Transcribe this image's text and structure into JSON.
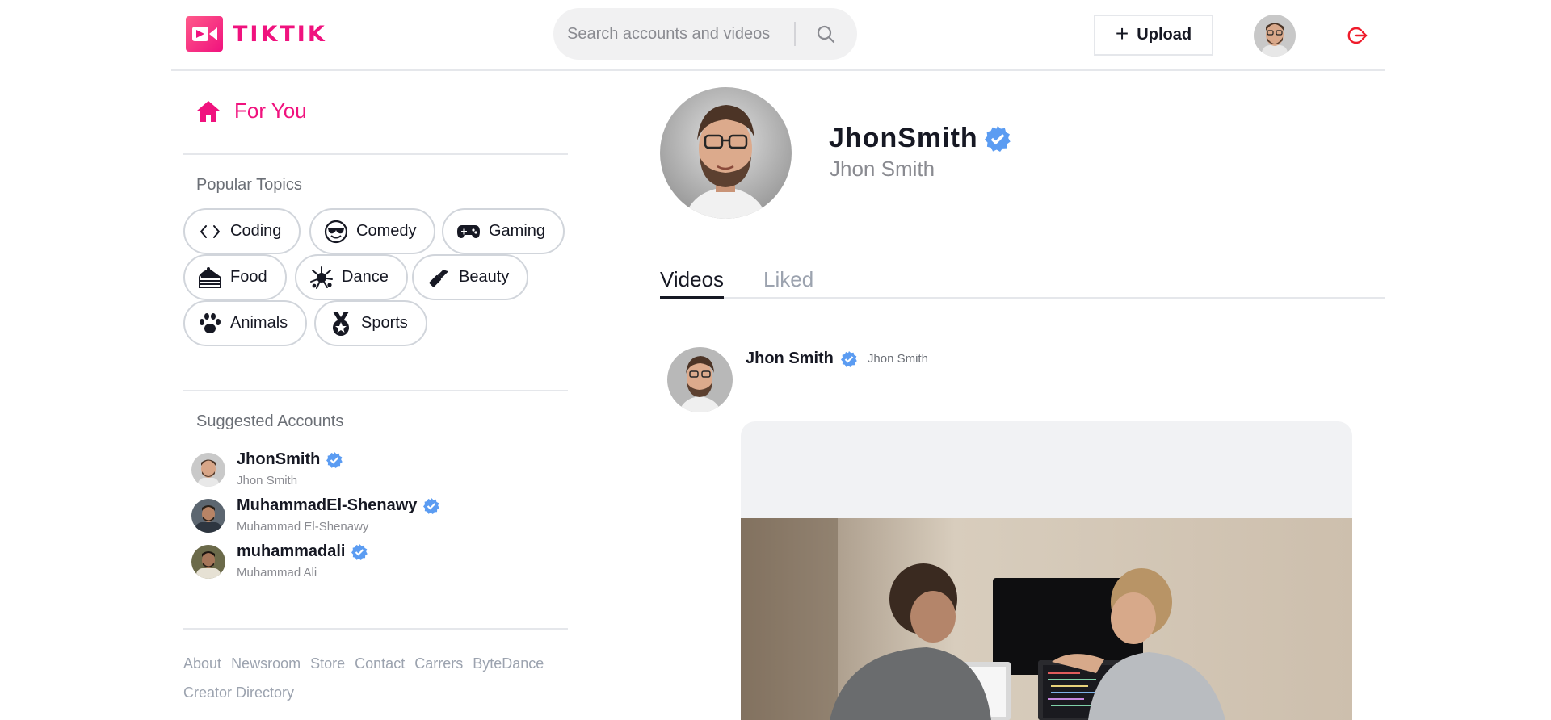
{
  "header": {
    "logo_text": "TIKTIK",
    "search": {
      "placeholder": "Search accounts and videos",
      "value": ""
    },
    "upload_label": "Upload",
    "brand_color": "#f0127e",
    "logout_icon": "logout-icon"
  },
  "sidebar": {
    "for_you_label": "For You",
    "popular_topics_title": "Popular Topics",
    "topics": [
      {
        "label": "Coding",
        "icon": "code-icon"
      },
      {
        "label": "Comedy",
        "icon": "sunglasses-emoji-icon"
      },
      {
        "label": "Gaming",
        "icon": "gamepad-icon"
      },
      {
        "label": "Food",
        "icon": "cake-slice-icon"
      },
      {
        "label": "Dance",
        "icon": "dance-splash-icon"
      },
      {
        "label": "Beauty",
        "icon": "lipstick-icon"
      },
      {
        "label": "Animals",
        "icon": "paw-icon"
      },
      {
        "label": "Sports",
        "icon": "medal-icon"
      }
    ],
    "suggested_title": "Suggested Accounts",
    "accounts": [
      {
        "username": "JhonSmith",
        "name": "Jhon Smith",
        "verified": true
      },
      {
        "username": "MuhammadEl-Shenawy",
        "name": "Muhammad El-Shenawy",
        "verified": true
      },
      {
        "username": "muhammadali",
        "name": "Muhammad Ali",
        "verified": true
      }
    ],
    "footer_links": [
      "About",
      "Newsroom",
      "Store",
      "Contact",
      "Carrers",
      "ByteDance",
      "Creator Directory"
    ]
  },
  "profile": {
    "username": "JhonSmith",
    "name": "Jhon Smith",
    "verified": true,
    "verified_color": "#5b9cf2"
  },
  "tabs": [
    {
      "label": "Videos",
      "active": true
    },
    {
      "label": "Liked",
      "active": false
    }
  ],
  "post": {
    "author_name": "Jhon Smith",
    "author_handle": "Jhon Smith",
    "verified": true
  }
}
